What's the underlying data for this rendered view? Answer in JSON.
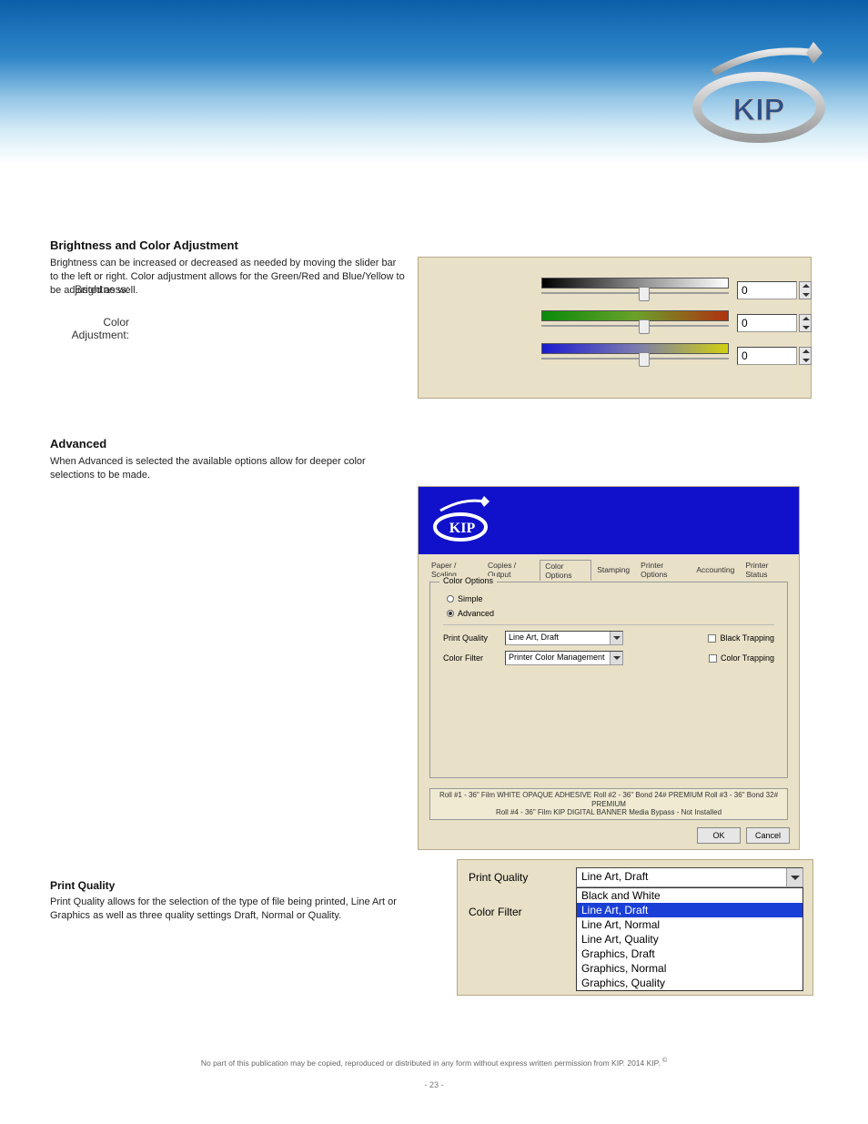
{
  "header": {
    "brand": "KIP"
  },
  "section1": {
    "title": "Brightness and Color Adjustment",
    "body": "Brightness can be increased or decreased as needed by moving the slider bar to the left or right. Color adjustment allows for the Green/Red and Blue/Yellow to be adjusted as well.",
    "rows": [
      {
        "label": "Brightness:",
        "value": "0",
        "thumb_pct": 52
      },
      {
        "label": "Color Adjustment:",
        "value": "0",
        "thumb_pct": 52
      },
      {
        "label": "",
        "value": "0",
        "thumb_pct": 52
      }
    ]
  },
  "section2": {
    "title": "Advanced",
    "body": "When Advanced is selected the available options allow for deeper color selections to be made.",
    "tabs": [
      "Paper / Scaling",
      "Copies / Output",
      "Color Options",
      "Stamping",
      "Printer Options",
      "Accounting",
      "Printer Status"
    ],
    "active_tab": 2,
    "group_title": "Color Options",
    "radios": [
      {
        "label": "Simple",
        "checked": false
      },
      {
        "label": "Advanced",
        "checked": true
      }
    ],
    "pq_label": "Print Quality",
    "pq_value": "Line Art, Draft",
    "cf_label": "Color Filter",
    "cf_value": "Printer Color Management",
    "chk1": "Black Trapping",
    "chk2": "Color Trapping",
    "foot_top": "Roll #1 - 36\" Film WHITE OPAQUE ADHESIVE    Roll #2 - 36\" Bond 24# PREMIUM    Roll #3 - 36\" Bond 32# PREMIUM",
    "foot_bot": "Roll #4 - 36\" Film KIP DIGITAL BANNER Media    Bypass - Not Installed",
    "btn_ok": "OK",
    "btn_cancel": "Cancel"
  },
  "section3": {
    "title": "Print Quality",
    "body": "Print Quality allows for the selection of the type of file being printed, Line Art or Graphics as well as three quality settings Draft, Normal or Quality.",
    "lab_pq": "Print Quality",
    "lab_cf": "Color Filter",
    "combo_value": "Line Art, Draft",
    "options": [
      "Black and White",
      "Line Art, Draft",
      "Line Art, Normal",
      "Line Art, Quality",
      "Graphics, Draft",
      "Graphics, Normal",
      "Graphics, Quality"
    ],
    "selected_index": 1
  },
  "footer": {
    "line1": "No part of this publication may be copied, reproduced or distributed in any form without express written permission from KIP.   2014 KIP.",
    "copyright": "©",
    "page": "- 23 -"
  }
}
